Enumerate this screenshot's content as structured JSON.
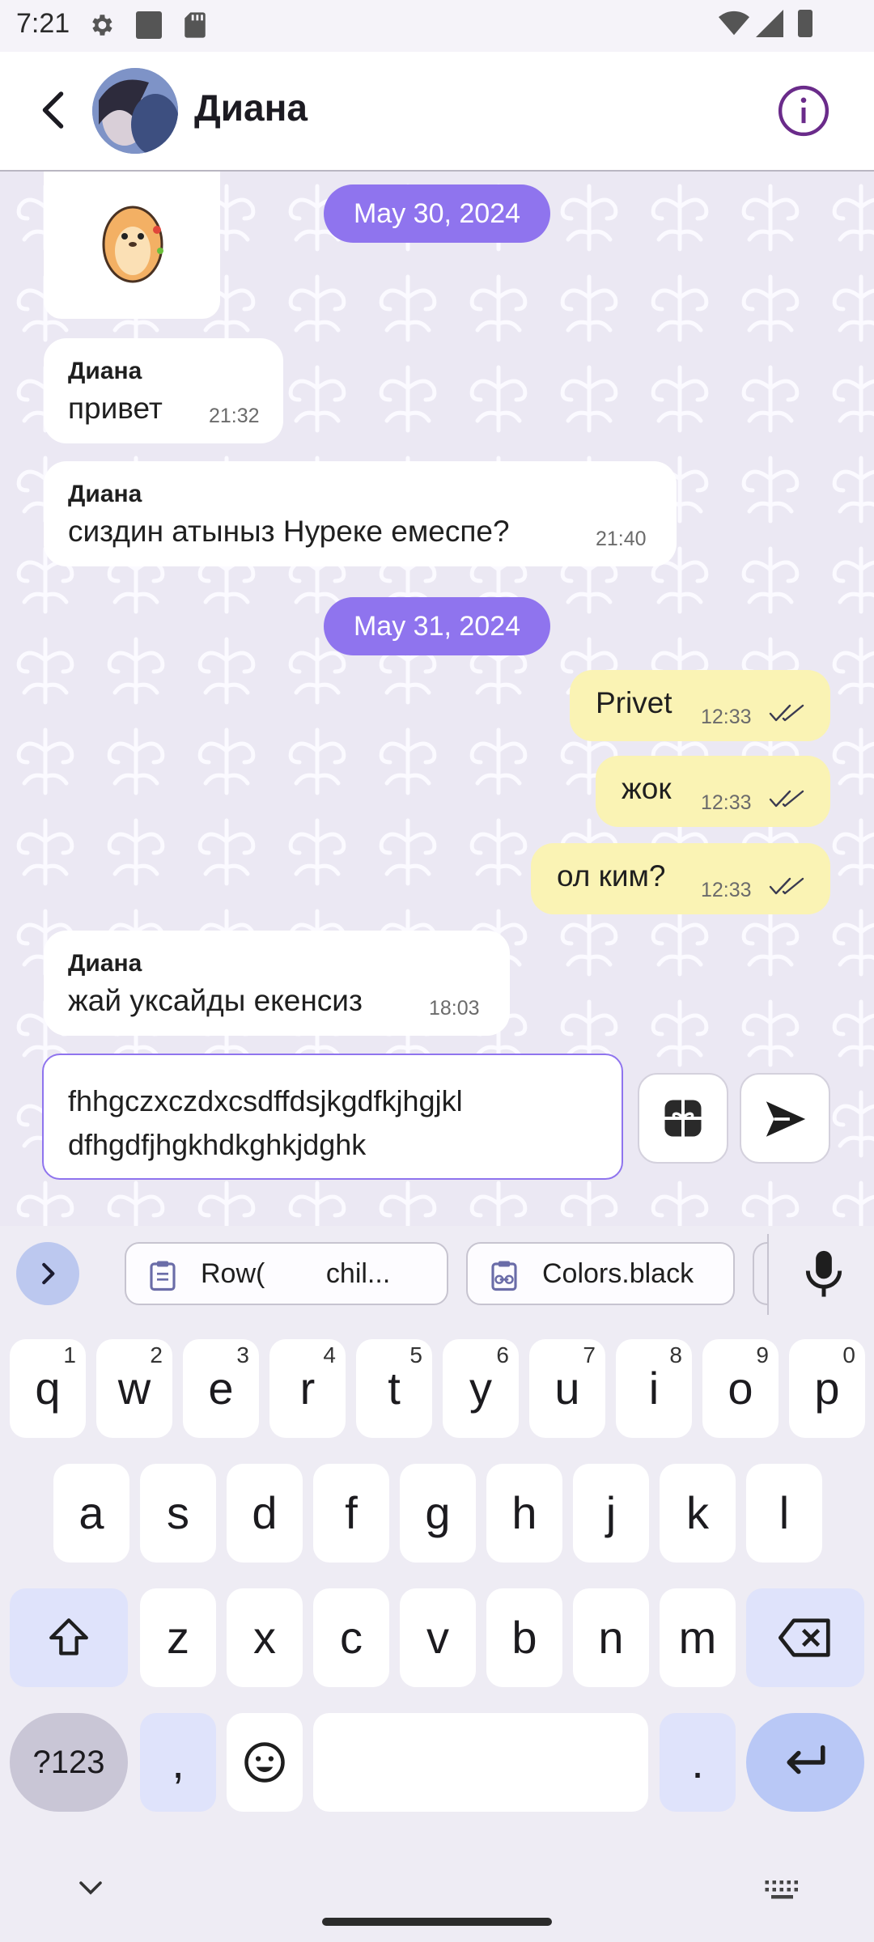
{
  "status_bar": {
    "time": "7:21"
  },
  "header": {
    "title": "Диана"
  },
  "chat": {
    "date1": "May 30, 2024",
    "date2": "May 31, 2024",
    "messages": [
      {
        "sender": "Диана",
        "text": "привет",
        "time": "21:32"
      },
      {
        "sender": "Диана",
        "text": "сиздин атыныз Нуреке емеспе?",
        "time": "21:40"
      },
      {
        "text": "Privet",
        "time": "12:33"
      },
      {
        "text": "жок",
        "time": "12:33"
      },
      {
        "text": "ол ким?",
        "time": "12:33"
      },
      {
        "sender": "Диана",
        "text": "жай уксайды екенсиз",
        "time": "18:03"
      }
    ]
  },
  "composer": {
    "value_line1": "fhhgczxczdxcsdffdsjkgdfkjhgjkl",
    "value_line2": "dfhgdfjhgkhdkghkjdghk"
  },
  "keyboard": {
    "suggestions": [
      "Row(        chil...",
      "Colors.black"
    ],
    "row1": [
      {
        "k": "q",
        "h": "1"
      },
      {
        "k": "w",
        "h": "2"
      },
      {
        "k": "e",
        "h": "3"
      },
      {
        "k": "r",
        "h": "4"
      },
      {
        "k": "t",
        "h": "5"
      },
      {
        "k": "y",
        "h": "6"
      },
      {
        "k": "u",
        "h": "7"
      },
      {
        "k": "i",
        "h": "8"
      },
      {
        "k": "o",
        "h": "9"
      },
      {
        "k": "p",
        "h": "0"
      }
    ],
    "row2": [
      "a",
      "s",
      "d",
      "f",
      "g",
      "h",
      "j",
      "k",
      "l"
    ],
    "row3": [
      "z",
      "x",
      "c",
      "v",
      "b",
      "n",
      "m"
    ],
    "symbols": "?123",
    "comma": ",",
    "period": "."
  },
  "colors": {
    "accent": "#8f74ee",
    "outgoing": "#faf3b4",
    "incoming": "#ffffff"
  }
}
